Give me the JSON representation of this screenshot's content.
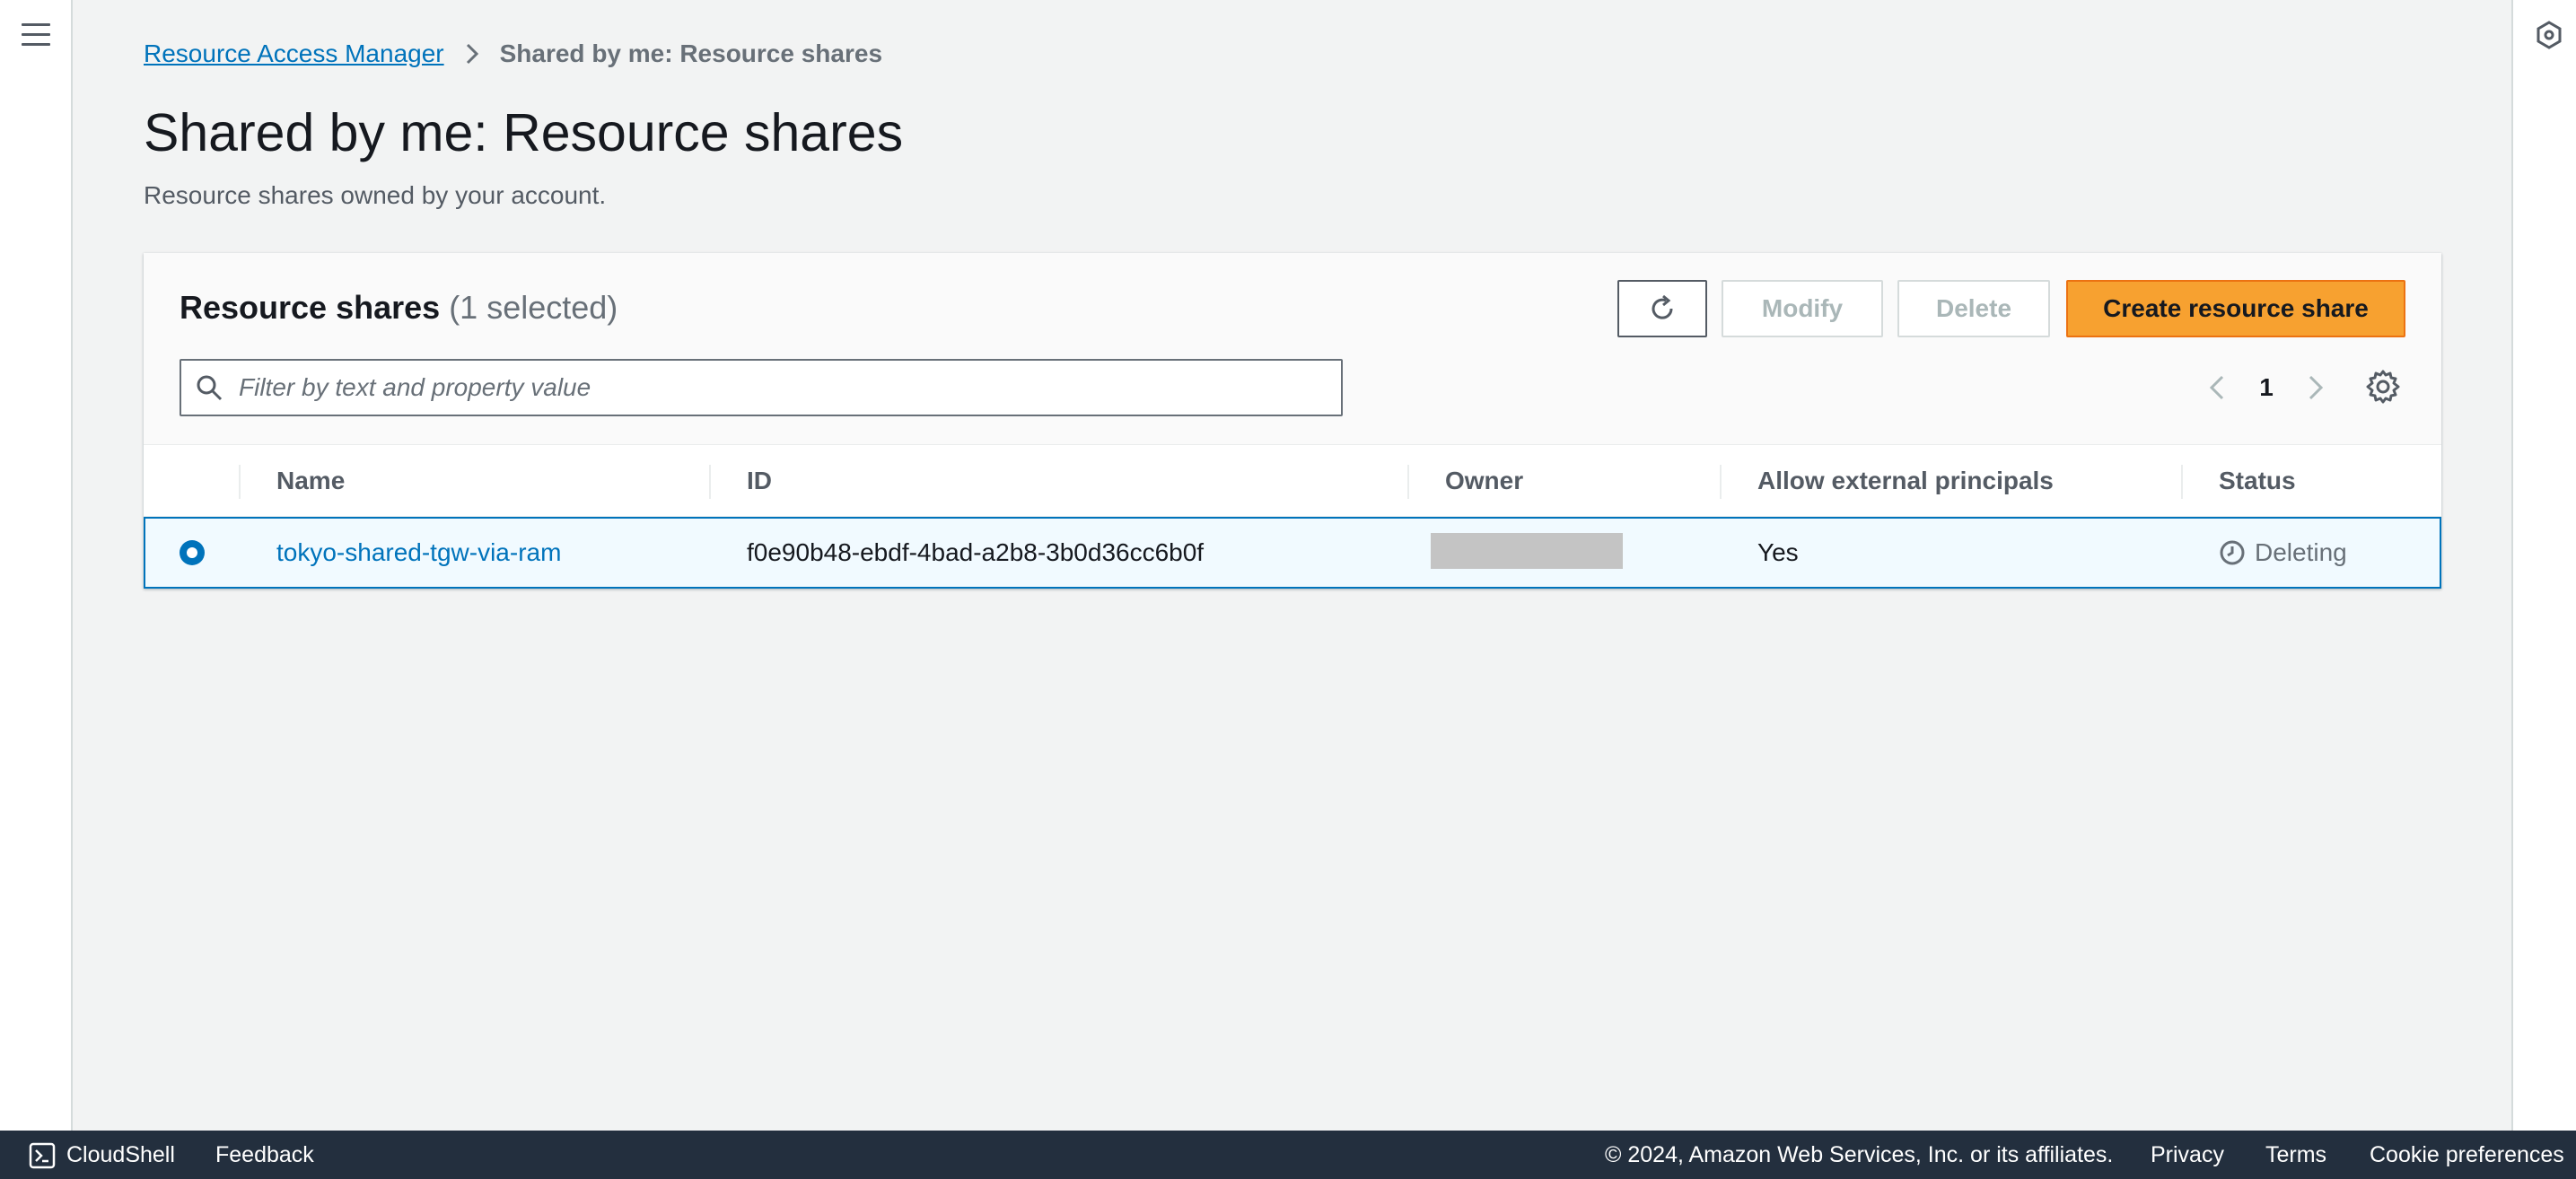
{
  "breadcrumb": {
    "parent": "Resource Access Manager",
    "current": "Shared by me: Resource shares"
  },
  "page": {
    "title": "Shared by me: Resource shares",
    "description": "Resource shares owned by your account."
  },
  "panel": {
    "title": "Resource shares",
    "count": "(1 selected)",
    "buttons": {
      "modify": "Modify",
      "delete": "Delete",
      "create": "Create resource share"
    },
    "filter_placeholder": "Filter by text and property value",
    "page_number": "1"
  },
  "table": {
    "columns": [
      "Name",
      "ID",
      "Owner",
      "Allow external principals",
      "Status"
    ],
    "rows": [
      {
        "name": "tokyo-shared-tgw-via-ram",
        "id": "f0e90b48-ebdf-4bad-a2b8-3b0d36cc6b0f",
        "owner": "",
        "allow_external": "Yes",
        "status": "Deleting",
        "selected": true
      }
    ]
  },
  "footer": {
    "cloudshell": "CloudShell",
    "feedback": "Feedback",
    "copyright": "© 2024, Amazon Web Services, Inc. or its affiliates.",
    "privacy": "Privacy",
    "terms": "Terms",
    "cookie": "Cookie preferences"
  },
  "colors": {
    "link": "#0073bb",
    "primary_button": "#f7a130",
    "footer_bg": "#232f3e",
    "selected_row_bg": "#f1faff"
  },
  "icons": [
    "menu-icon",
    "chevron-right-icon",
    "refresh-icon",
    "search-icon",
    "chevron-left-icon",
    "settings-icon",
    "clock-icon",
    "cloudshell-icon",
    "hexagon-icon"
  ]
}
